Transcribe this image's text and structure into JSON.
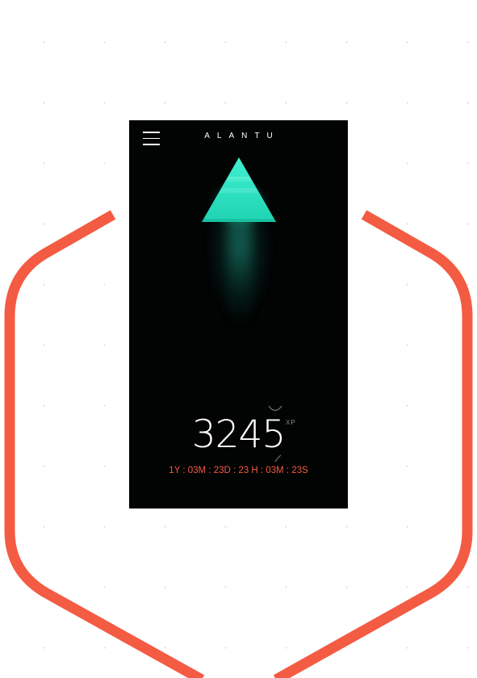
{
  "app": {
    "brand_name": "ALANTU"
  },
  "header": {
    "menu_icon": "hamburger-menu-icon"
  },
  "hero": {
    "icon": "pyramid-icon",
    "accent_color": "#2ee6c4"
  },
  "stats": {
    "xp_value": "3245",
    "xp_unit": "XP",
    "countdown": "1Y : 03M : 23D : 23 H : 03M : 23S"
  },
  "colors": {
    "hexagon_stroke": "#f45b43",
    "screen_background": "#020303",
    "countdown_text": "#f45b43"
  }
}
